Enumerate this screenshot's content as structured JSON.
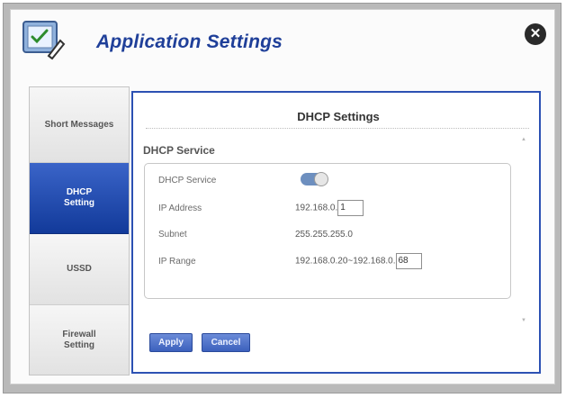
{
  "header": {
    "title": "Application Settings",
    "close_icon": "close-icon",
    "app_icon": "settings-checklist-icon"
  },
  "sidebar": {
    "items": [
      {
        "label": "Short Messages"
      },
      {
        "label": "DHCP Setting",
        "active": true
      },
      {
        "label": "USSD"
      },
      {
        "label": "Firewall Setting"
      }
    ]
  },
  "panel": {
    "title": "DHCP Settings",
    "section_label": "DHCP Service",
    "rows": {
      "service_label": "DHCP Service",
      "service_enabled": true,
      "ip_label": "IP Address",
      "ip_prefix": "192.168.0.",
      "ip_last": "1",
      "subnet_label": "Subnet",
      "subnet_value": "255.255.255.0",
      "range_label": "IP Range",
      "range_prefix": "192.168.0.20~192.168.0.",
      "range_last": "68"
    }
  },
  "buttons": {
    "apply": "Apply",
    "cancel": "Cancel"
  },
  "colors": {
    "accent": "#2c51b3",
    "title": "#1f3f99",
    "active_tab": "#1e47ad"
  }
}
